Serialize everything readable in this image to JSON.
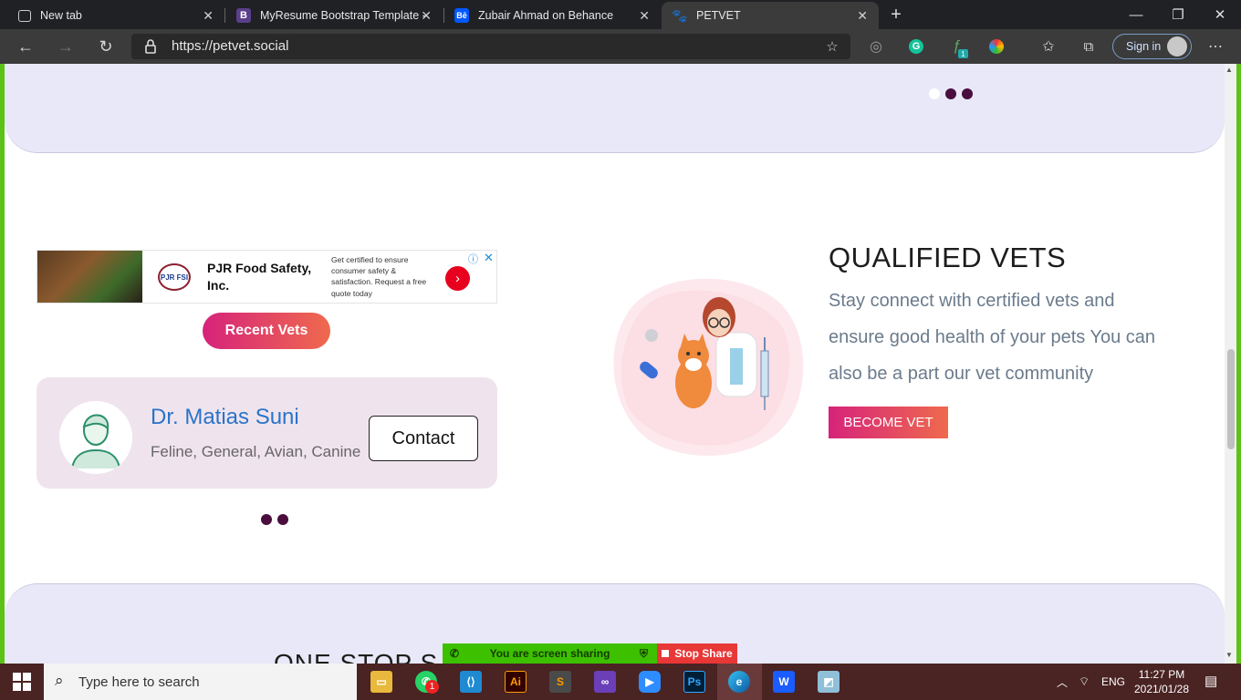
{
  "browser": {
    "tabs": [
      {
        "title": "New tab"
      },
      {
        "title": "MyResume Bootstrap Template -"
      },
      {
        "title": "Zubair Ahmad on Behance"
      },
      {
        "title": "PETVET"
      }
    ],
    "url": "https://petvet.social",
    "signin_label": "Sign in",
    "extension_badge": "1"
  },
  "ad": {
    "title": "PJR Food Safety, Inc.",
    "logo_text": "PJR FSI",
    "description": "Get certified to ensure consumer safety & satisfaction. Request a free quote today"
  },
  "vets": {
    "recent_label": "Recent Vets",
    "card": {
      "name": "Dr. Matias Suni",
      "specialties": "Feline, General, Avian, Canine",
      "contact_label": "Contact"
    }
  },
  "qualified": {
    "title": "QUALIFIED VETS",
    "text": "Stay connect with certified vets and ensure good health of your pets You can also be a part our vet community",
    "button_label": "BECOME VET"
  },
  "next_section_title": "ONE STOP S",
  "screen_share": {
    "message": "You are screen sharing",
    "stop_label": "Stop Share"
  },
  "taskbar": {
    "search_placeholder": "Type here to search",
    "whatsapp_badge": "1",
    "language": "ENG",
    "time": "11:27 PM",
    "date": "2021/01/28"
  },
  "colors": {
    "accent_gradient_start": "#d6237b",
    "accent_gradient_end": "#ef6a4d",
    "carousel_dot": "#4a0d3e",
    "band_background": "#e8e8f8",
    "vet_name": "#2a73c8"
  }
}
